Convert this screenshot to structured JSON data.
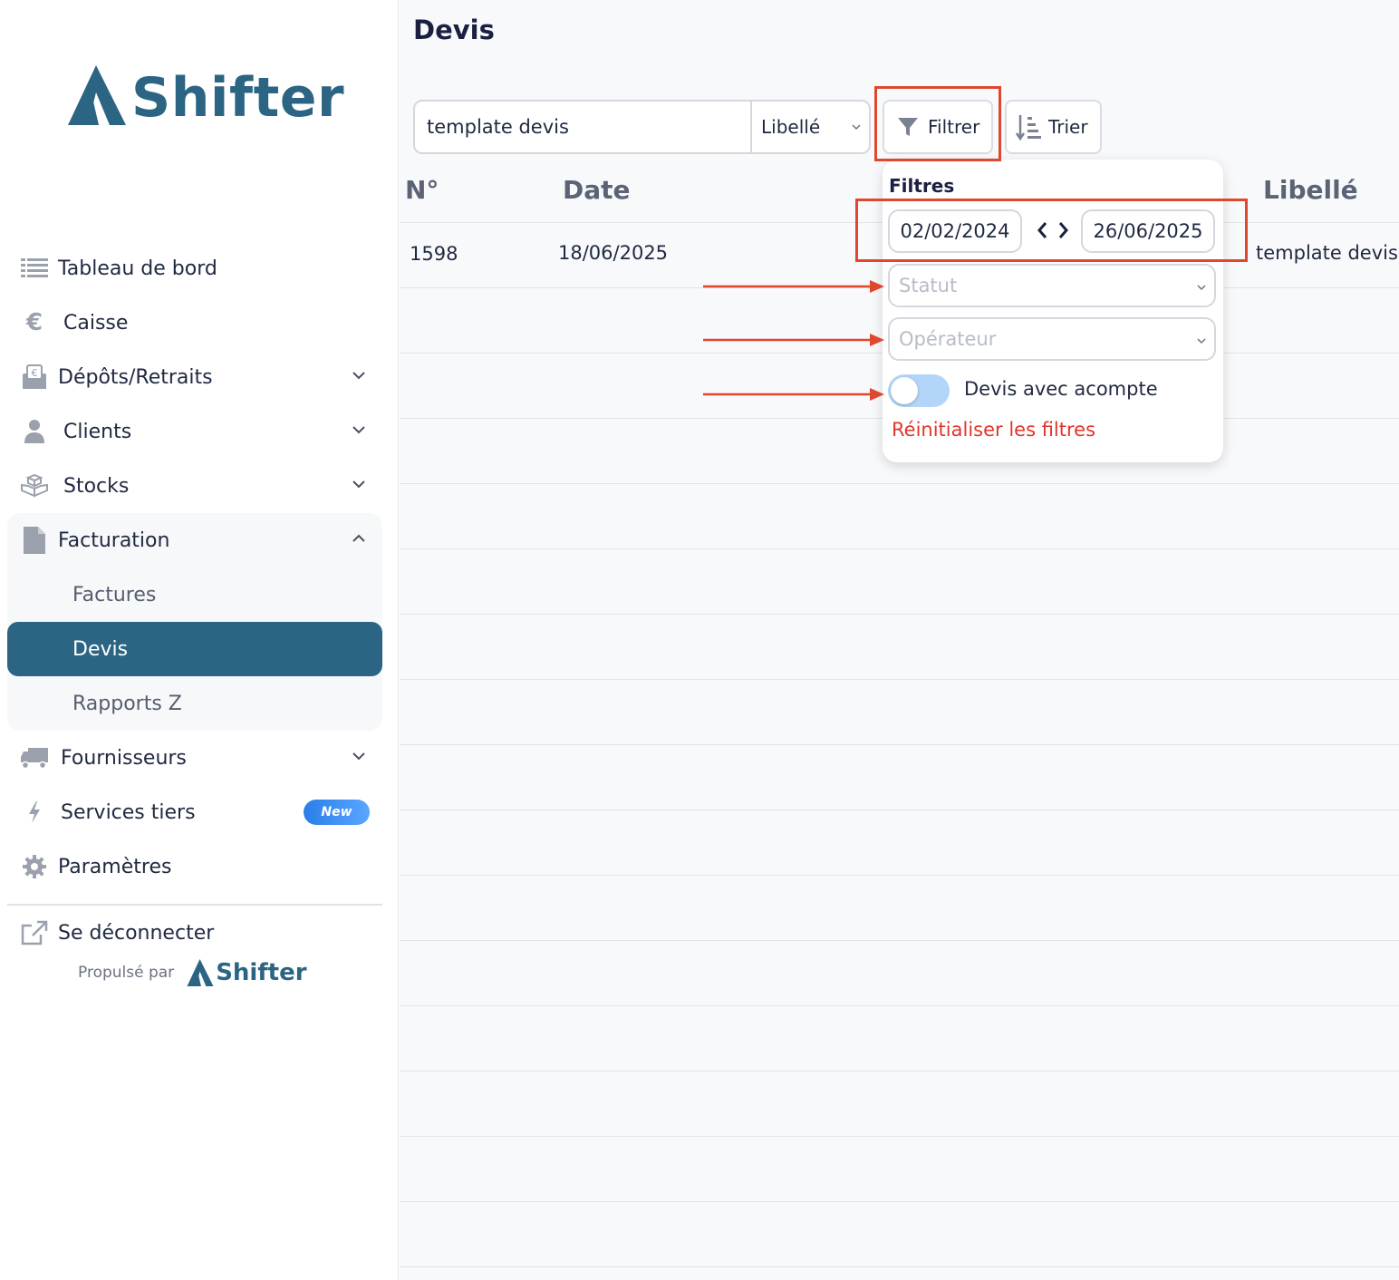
{
  "app": {
    "brand": "Shifter",
    "powered_by": "Propulsé par",
    "powered_brand": "Shifter"
  },
  "sidebar": {
    "items": [
      {
        "label": "Tableau de bord",
        "icon": "list-icon"
      },
      {
        "label": "Caisse",
        "icon": "euro-icon"
      },
      {
        "label": "Dépôts/Retraits",
        "icon": "envelope-euro-icon",
        "expandable": true
      },
      {
        "label": "Clients",
        "icon": "user-icon",
        "expandable": true
      },
      {
        "label": "Stocks",
        "icon": "boxes-icon",
        "expandable": true
      },
      {
        "label": "Facturation",
        "icon": "document-icon",
        "expanded": true
      },
      {
        "label": "Fournisseurs",
        "icon": "truck-icon",
        "expandable": true
      },
      {
        "label": "Services tiers",
        "icon": "bolt-icon",
        "badge": "New"
      },
      {
        "label": "Paramètres",
        "icon": "gear-icon"
      }
    ],
    "facturation_sub": [
      {
        "label": "Factures"
      },
      {
        "label": "Devis",
        "active": true
      },
      {
        "label": "Rapports Z"
      }
    ],
    "logout": {
      "label": "Se déconnecter",
      "icon": "external-link-icon"
    }
  },
  "main": {
    "title": "Devis",
    "search": {
      "value": "template devis",
      "field": "Libellé"
    },
    "filter_button": "Filtrer",
    "sort_button": "Trier",
    "columns": {
      "number": "N°",
      "date": "Date",
      "label": "Libellé"
    },
    "rows": [
      {
        "number": "1598",
        "date": "18/06/2025",
        "label": "template devis"
      }
    ]
  },
  "filters": {
    "title": "Filtres",
    "date_from": "02/02/2024",
    "date_to": "26/06/2025",
    "status_placeholder": "Statut",
    "operator_placeholder": "Opérateur",
    "deposit_toggle_label": "Devis avec acompte",
    "deposit_toggle_on": false,
    "reset_label": "Réinitialiser les filtres"
  },
  "colors": {
    "brand": "#2c6584",
    "annotation": "#e0472f",
    "reset": "#e0352b",
    "badge": "#2a7ee8"
  }
}
